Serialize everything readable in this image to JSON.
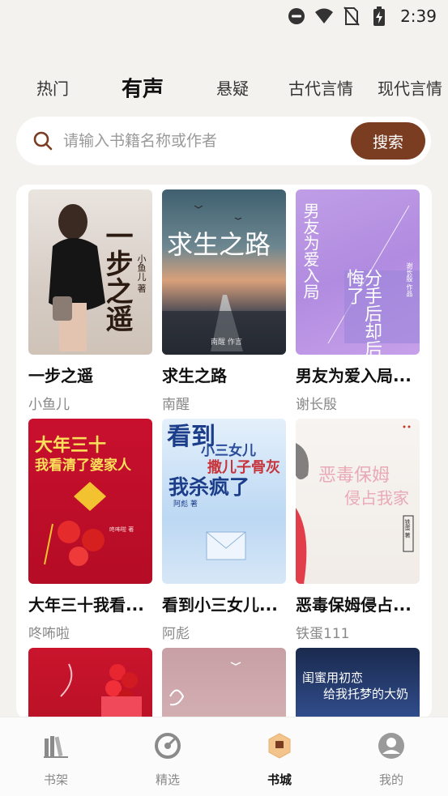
{
  "status_bar": {
    "time": "2:39",
    "icons": [
      "dnd-icon",
      "wifi-icon",
      "no-sim-icon",
      "battery-charging-icon"
    ]
  },
  "tabs": [
    {
      "label": "热门",
      "active": false
    },
    {
      "label": "有声",
      "active": true
    },
    {
      "label": "悬疑",
      "active": false
    },
    {
      "label": "古代言情",
      "active": false
    },
    {
      "label": "现代言情",
      "active": false
    }
  ],
  "search": {
    "placeholder": "请输入书籍名称或作者",
    "value": "",
    "button_label": "搜索",
    "icon": "search-icon"
  },
  "books": [
    {
      "title": "一步之遥",
      "author": "小鱼儿",
      "cover_text": "一步之遥",
      "cover_author_line": "小鱼儿 著"
    },
    {
      "title": "求生之路",
      "author": "南醒",
      "cover_text": "求生之路",
      "cover_author_line": "南醒 作言"
    },
    {
      "title": "男友为爱入局...",
      "author": "谢长殷",
      "cover_text": "男友为爱入局",
      "cover_text_2": "分手后却后悔了",
      "cover_author_line": "谢长殷 作品"
    },
    {
      "title": "大年三十我看...",
      "author": "咚咘啦",
      "cover_text": "大年三十",
      "cover_text_2": "我看清了婆家人",
      "cover_author_line": "咚咘啦 著"
    },
    {
      "title": "看到小三女儿...",
      "author": "阿彪",
      "cover_text": "看到",
      "cover_text_2": "小三女儿",
      "cover_text_3": "撒儿子骨灰",
      "cover_text_4": "我杀疯了",
      "cover_author_line": "阿彪 著"
    },
    {
      "title": "恶毒保姆侵占...",
      "author": "铁蛋111",
      "cover_text": "恶毒保姆",
      "cover_text_2": "侵占我家",
      "cover_author_line": "铁蛋 著"
    },
    {
      "title": "",
      "author": "",
      "cover_text": ""
    },
    {
      "title": "",
      "author": "",
      "cover_text": ""
    },
    {
      "title": "",
      "author": "",
      "cover_text": "闺蜜用初恋",
      "cover_text_2": "给我托梦的大奶"
    }
  ],
  "bottom_nav": [
    {
      "label": "书架",
      "icon": "bookshelf-icon",
      "active": false
    },
    {
      "label": "精选",
      "icon": "featured-icon",
      "active": false
    },
    {
      "label": "书城",
      "icon": "bookstore-icon",
      "active": true
    },
    {
      "label": "我的",
      "icon": "profile-icon",
      "active": false
    }
  ],
  "colors": {
    "accent": "#7a3d22",
    "background": "#f4f2ef",
    "panel": "#ffffff",
    "muted_text": "#888888"
  }
}
